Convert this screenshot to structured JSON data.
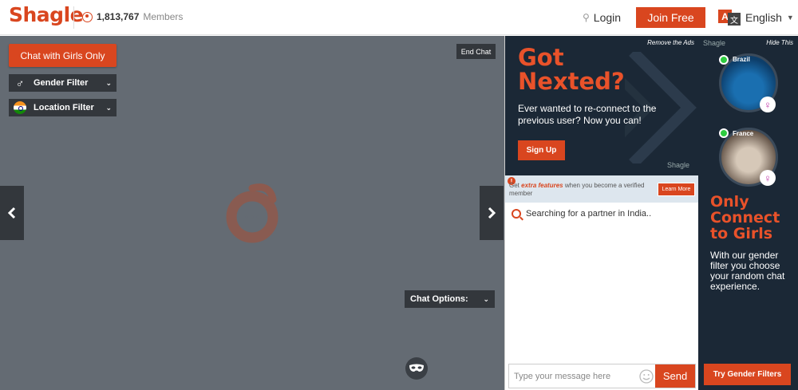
{
  "header": {
    "logo": "Shagle",
    "member_count": "1,813,767",
    "members_label": "Members",
    "login": "Login",
    "join": "Join Free",
    "language": "English"
  },
  "video": {
    "chat_girls": "Chat with Girls Only",
    "gender_filter": "Gender Filter",
    "location_filter": "Location Filter",
    "end_chat": "End Chat",
    "chat_options": "Chat Options:"
  },
  "ad1": {
    "remove": "Remove the Ads",
    "headline_1": "Got",
    "headline_2": "Nexted?",
    "sub": "Ever wanted to re-connect to the previous user? Now you can!",
    "signup": "Sign Up",
    "brand": "Shagle"
  },
  "promo": {
    "prefix": "Get",
    "highlight": "extra features",
    "suffix": "when you become a verified member",
    "learn_more": "Learn More"
  },
  "chat": {
    "searching": "Searching for a partner in India..",
    "placeholder": "Type your message here",
    "send": "Send"
  },
  "ad2": {
    "brand": "Shagle",
    "hide": "Hide This",
    "country_1": "Brazil",
    "country_2": "France",
    "title_1": "Only",
    "title_2": "Connect",
    "title_3": "to Girls",
    "desc": "With our gender filter you choose your random chat experience.",
    "try": "Try Gender Filters"
  },
  "colors": {
    "accent": "#d9461f",
    "dark_panel": "#33373c",
    "video_bg": "#646b73",
    "ad_bg": "#1b2836"
  }
}
